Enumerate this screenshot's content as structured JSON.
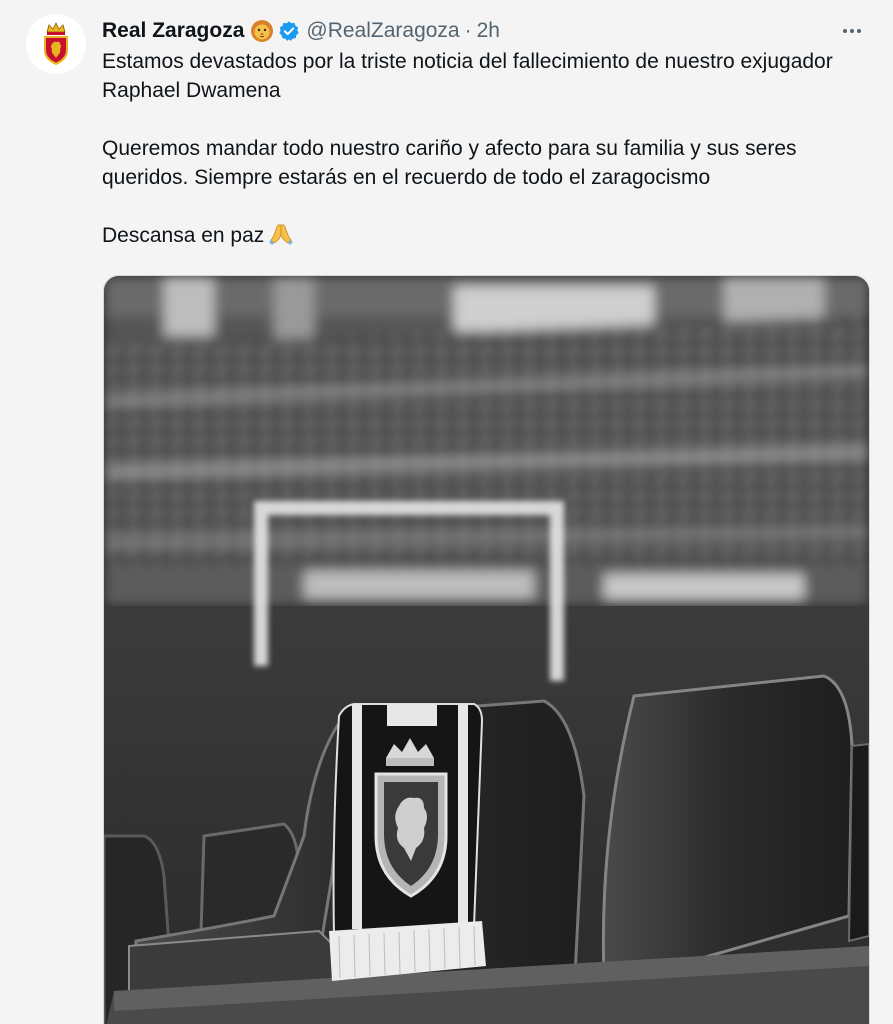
{
  "tweet": {
    "display_name": "Real Zaragoza",
    "name_emoji_icon": "lion-face-icon",
    "verified_icon": "verified-badge-icon",
    "handle": "@RealZaragoza",
    "separator": "·",
    "time": "2h",
    "more_icon": "more-horizontal-icon",
    "paragraphs": [
      "Estamos devastados por la triste noticia del fallecimiento de nuestro exjugador Raphael Dwamena",
      "Queremos mandar todo nuestro cariño y afecto para su familia y sus seres queridos. Siempre estarás en el recuerdo de todo el zaragocismo",
      "Descansa en paz"
    ],
    "closing_emoji_icon": "folded-hands-icon"
  },
  "colors": {
    "background": "#f4f4f4",
    "text": "#0f1419",
    "secondary_text": "#536471",
    "verified_blue": "#1d9bf0",
    "crest_red": "#c8102e",
    "crest_gold": "#e8b422"
  }
}
